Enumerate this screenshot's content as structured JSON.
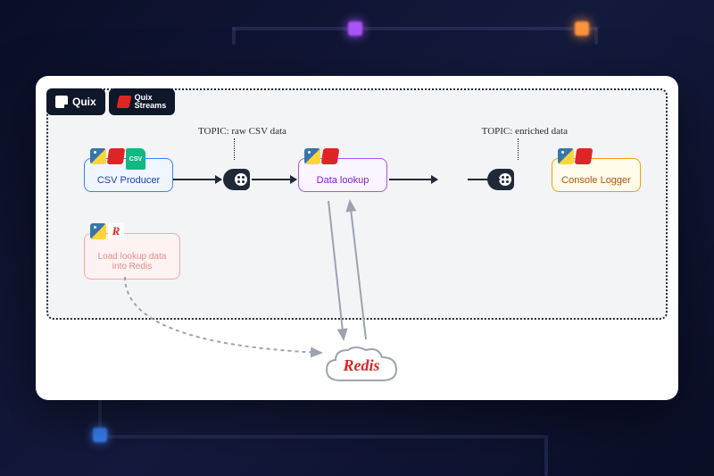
{
  "badges": {
    "quix": "Quix",
    "streams_l1": "Quix",
    "streams_l2": "Streams"
  },
  "topics": {
    "raw": "TOPIC: raw CSV data",
    "enriched": "TOPIC: enriched data"
  },
  "nodes": {
    "csv_producer": "CSV Producer",
    "load_redis_l1": "Load lookup data",
    "load_redis_l2": "into Redis",
    "data_lookup": "Data lookup",
    "console_logger": "Console Logger",
    "csv_tag": "CSV",
    "r_tag": "R"
  },
  "redis": "Redis"
}
